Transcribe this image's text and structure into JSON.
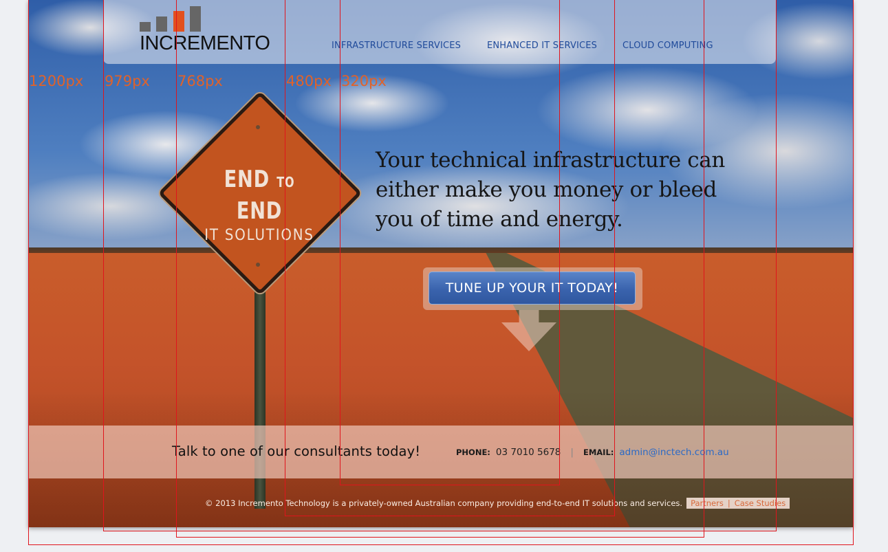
{
  "brand": {
    "name": "INCREMENTO",
    "colors": {
      "accent": "#e2501e",
      "logo_bars": "#666666",
      "nav_link": "#1f4a9a",
      "cta": "#3a63ad",
      "email_link": "#2b6ac6",
      "guide_lines": "#e0141c",
      "width_labels": "#e0622a"
    }
  },
  "nav": {
    "items": [
      {
        "label": "INFRASTRUCTURE SERVICES"
      },
      {
        "label": "ENHANCED IT SERVICES"
      },
      {
        "label": "CLOUD COMPUTING"
      }
    ]
  },
  "breakpoints": {
    "labels": [
      "1200px",
      "979px",
      "768px",
      "480px",
      "320px"
    ]
  },
  "hero": {
    "sign": {
      "line1_a": "END",
      "line1_b": "TO",
      "line1_c": "END",
      "line2": "IT  SOLUTIONS"
    },
    "tagline": "Your technical infrastructure can either make you money or bleed you of time and energy.",
    "cta_label": "TUNE UP YOUR IT TODAY!",
    "cta_arrow_icon": "down-arrow-icon"
  },
  "contact": {
    "title": "Talk to one of our consultants today!",
    "phone_label": "PHONE:",
    "phone": "03 7010 5678",
    "separator": "|",
    "email_label": "EMAIL:",
    "email": "admin@inctech.com.au"
  },
  "footer": {
    "copyright": "© 2013 Incremento Technology is a privately-owned Australian company providing end-to-end IT solutions and services.",
    "links": [
      {
        "label": "Partners"
      },
      {
        "label": "Case Studies"
      }
    ],
    "link_separator": "|"
  }
}
